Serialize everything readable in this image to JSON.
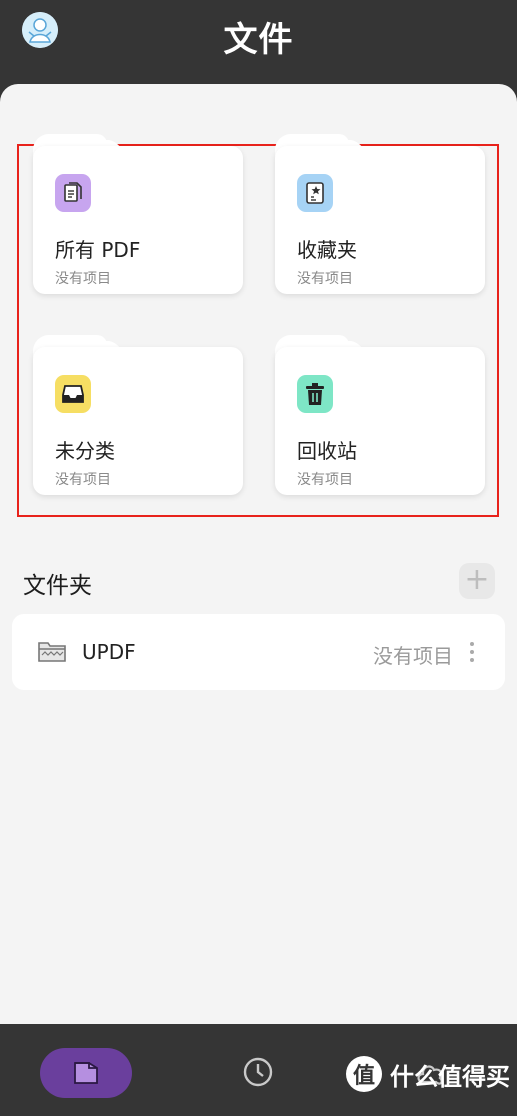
{
  "header": {
    "title": "文件",
    "avatar_icon": "avatar-icon"
  },
  "categories": [
    {
      "name": "所有 PDF",
      "sub": "没有项目",
      "icon": "pdf-docs-icon",
      "color": "#c7a5ef"
    },
    {
      "name": "收藏夹",
      "sub": "没有项目",
      "icon": "star-doc-icon",
      "color": "#a6d3f5"
    },
    {
      "name": "未分类",
      "sub": "没有项目",
      "icon": "inbox-icon",
      "color": "#f6de63"
    },
    {
      "name": "回收站",
      "sub": "没有项目",
      "icon": "trash-icon",
      "color": "#7ee6c6"
    }
  ],
  "folders_section": {
    "title": "文件夹",
    "add_icon": "plus-icon"
  },
  "folders": [
    {
      "name": "UPDF",
      "count": "没有项目",
      "icon": "folder-icon",
      "more_icon": "more-vertical-icon"
    }
  ],
  "bottom_nav": {
    "items": [
      {
        "icon": "folder-nav-icon",
        "active": true
      },
      {
        "icon": "clock-icon",
        "active": false
      },
      {
        "icon": "cloud-icon",
        "active": false
      }
    ],
    "active_color": "#6a3f9d"
  },
  "watermark": {
    "badge": "值",
    "text": "什么值得买"
  },
  "colors": {
    "highlight_frame": "#e8221b",
    "background": "#f4f4f4",
    "topbar": "#353535"
  }
}
